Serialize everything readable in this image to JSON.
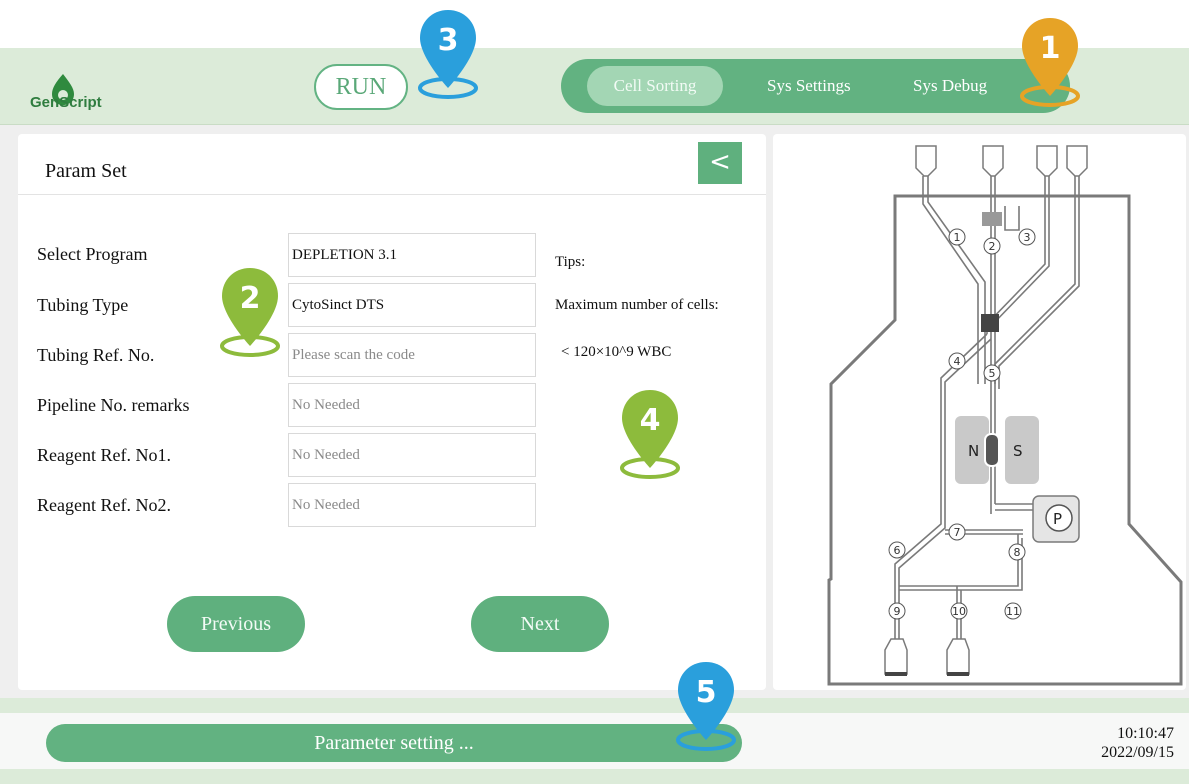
{
  "header": {
    "logo_text": "GenScript",
    "run_label": "RUN",
    "nav": [
      {
        "label": "Cell Sorting",
        "active": true
      },
      {
        "label": "Sys Settings",
        "active": false
      },
      {
        "label": "Sys Debug",
        "active": false
      }
    ]
  },
  "param_panel": {
    "title": "Param Set",
    "back_icon": "chevron-left-icon",
    "fields": [
      {
        "label": "Select Program",
        "value": "DEPLETION  3.1",
        "placeholder": ""
      },
      {
        "label": "Tubing Type",
        "value": "CytoSinct  DTS",
        "placeholder": ""
      },
      {
        "label": "Tubing Ref. No.",
        "value": "",
        "placeholder": "Please scan the code"
      },
      {
        "label": "Pipeline No. remarks",
        "value": "",
        "placeholder": "No Needed"
      },
      {
        "label": "Reagent Ref. No1.",
        "value": "",
        "placeholder": "No Needed"
      },
      {
        "label": "Reagent Ref. No2.",
        "value": "",
        "placeholder": "No Needed"
      }
    ],
    "tips": {
      "heading": "Tips:",
      "line1": "Maximum number of cells:",
      "line2": "< 120×10^9   WBC"
    },
    "previous_label": "Previous",
    "next_label": "Next"
  },
  "diagram": {
    "valves": [
      "1",
      "2",
      "3",
      "4",
      "5",
      "6",
      "7",
      "8",
      "9",
      "10",
      "11"
    ],
    "magnet_left": "N",
    "magnet_right": "S",
    "pump_label": "P"
  },
  "status": {
    "text": "Parameter setting ...",
    "time": "10:10:47",
    "date": "2022/09/15"
  },
  "markers": [
    "1",
    "2",
    "3",
    "4",
    "5"
  ],
  "colors": {
    "accent_green": "#62b281",
    "header_bg": "#dcebd9",
    "marker_orange": "#e6a326",
    "marker_blue": "#2a9fdc",
    "marker_lime": "#8dbb3c"
  }
}
